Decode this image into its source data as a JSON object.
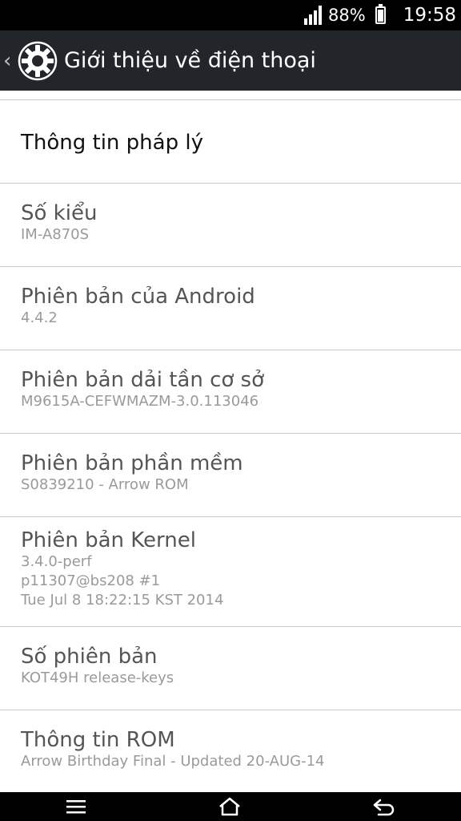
{
  "status_bar": {
    "battery_percent": "88%",
    "time": "19:58",
    "signal_icon": "signal-icon",
    "battery_icon": "battery-icon"
  },
  "action_bar": {
    "title": "Giới thiệu về điện thoại",
    "back_icon": "chevron-left-icon",
    "app_icon": "gear-icon"
  },
  "items": [
    {
      "title": "Thông tin pháp lý"
    },
    {
      "title": "Số kiểu",
      "subtitle": "IM-A870S"
    },
    {
      "title": "Phiên bản của Android",
      "subtitle": "4.4.2"
    },
    {
      "title": "Phiên bản dải tần cơ sở",
      "subtitle": "M9615A-CEFWMAZM-3.0.113046"
    },
    {
      "title": "Phiên bản phần mềm",
      "subtitle": "S0839210 - Arrow ROM"
    },
    {
      "title": "Phiên bản Kernel",
      "subtitle_lines": [
        "3.4.0-perf",
        "p11307@bs208 #1",
        "Tue Jul 8 18:22:15 KST 2014"
      ]
    },
    {
      "title": "Số phiên bản",
      "subtitle": "KOT49H release-keys"
    },
    {
      "title": "Thông tin ROM",
      "subtitle": "Arrow Birthday Final - Updated 20-AUG-14"
    }
  ],
  "nav_bar": {
    "menu_icon": "menu-icon",
    "home_icon": "home-icon",
    "back_icon": "back-icon"
  }
}
